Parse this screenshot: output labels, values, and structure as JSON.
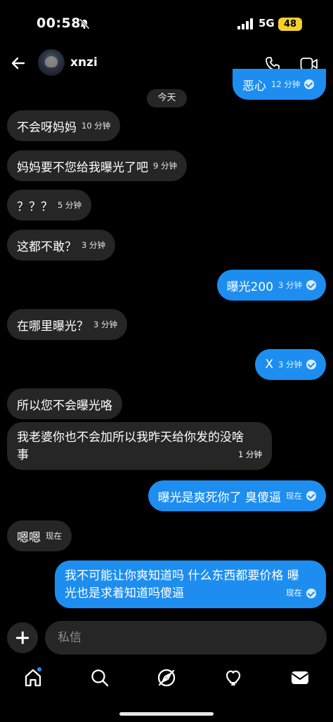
{
  "status_bar": {
    "time": "00:58",
    "network": "5G",
    "battery": "48"
  },
  "header": {
    "username": "xnzi"
  },
  "date_divider": "今天",
  "messages": [
    {
      "dir": "out",
      "text": "恶心",
      "time": "12 分钟"
    },
    {
      "dir": "in",
      "text": "不会呀妈妈",
      "time": "10 分钟"
    },
    {
      "dir": "in",
      "text": "妈妈要不您给我曝光了吧",
      "time": "9 分钟"
    },
    {
      "dir": "in",
      "text": "？？？",
      "time": "5 分钟"
    },
    {
      "dir": "in",
      "text": "这都不敢？",
      "time": "3 分钟"
    },
    {
      "dir": "out",
      "text": "曝光200",
      "time": "3 分钟"
    },
    {
      "dir": "in",
      "text": "在哪里曝光？",
      "time": "3 分钟"
    },
    {
      "dir": "out",
      "text": "X",
      "time": "3 分钟"
    },
    {
      "dir": "in",
      "text": "所以您不会曝光咯",
      "time": ""
    },
    {
      "dir": "in",
      "text_line1": "我老婆你也不会加所以我昨天给你发的没啥",
      "text_line2": "事",
      "time": "1 分钟"
    },
    {
      "dir": "out",
      "text": "曝光是爽死你了 臭傻逼",
      "time": "现在"
    },
    {
      "dir": "in",
      "text": "嗯嗯",
      "time": "现在"
    },
    {
      "dir": "out",
      "text_line1": "我不可能让你爽知道吗 什么东西都要价格 曝",
      "text_line2": "光也是求着知道吗傻逼",
      "time": "现在"
    }
  ],
  "composer": {
    "placeholder": "私信"
  },
  "nav": {
    "items": [
      "home-icon",
      "search-icon",
      "explore-icon",
      "heart-icon",
      "messages-icon"
    ]
  },
  "colors": {
    "outgoing": "#1d8ef0",
    "incoming": "#262626",
    "battery": "#f5cf2a"
  }
}
